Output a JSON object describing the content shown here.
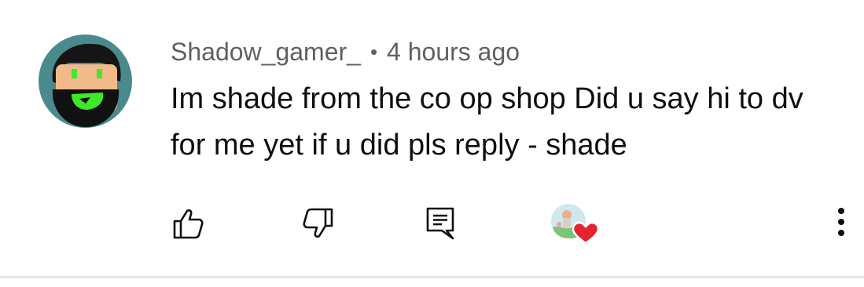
{
  "comment": {
    "author": "Shadow_gamer_",
    "separator": "•",
    "time": "4 hours ago",
    "text": "Im shade from the co op shop Did u say hi to dv for me yet if u did pls reply - shade"
  },
  "actions": {
    "like_icon": "thumb-up-icon",
    "dislike_icon": "thumb-down-icon",
    "reply_icon": "reply-comment-icon",
    "creator_heart_icon": "creator-heart-icon",
    "more_icon": "vertical-dots-icon"
  },
  "colors": {
    "meta_text": "#606060",
    "body_text": "#0f0f0f",
    "heart": "#e6232e",
    "avatar_bg": "#4a8a8c",
    "avatar_glow": "#3ee82a"
  }
}
